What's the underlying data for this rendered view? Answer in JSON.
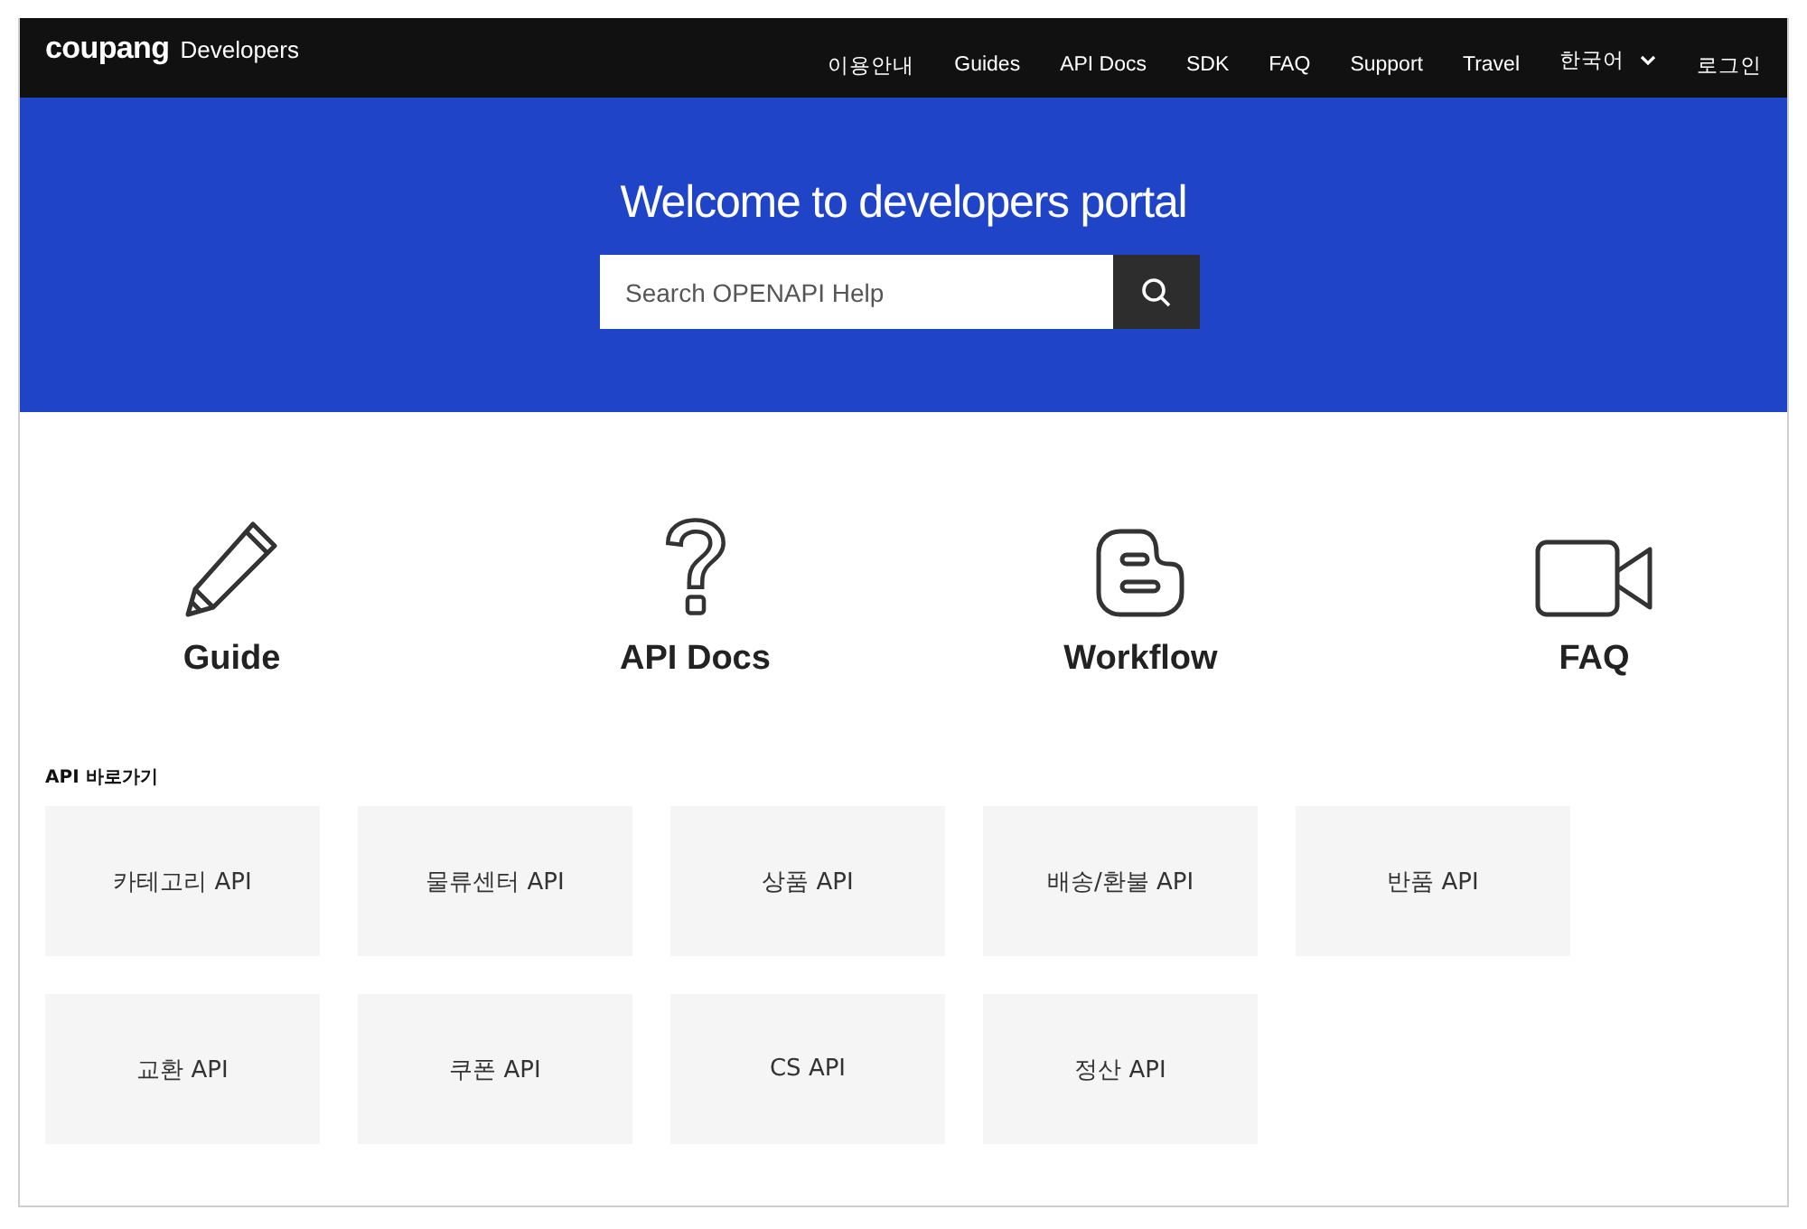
{
  "header": {
    "logo": "coupang",
    "logo_suffix": "Developers",
    "nav": [
      {
        "label": "이용안내"
      },
      {
        "label": "Guides"
      },
      {
        "label": "API Docs"
      },
      {
        "label": "SDK"
      },
      {
        "label": "FAQ"
      },
      {
        "label": "Support"
      },
      {
        "label": "Travel"
      }
    ],
    "language": "한국어",
    "login": "로그인"
  },
  "hero": {
    "title": "Welcome to developers portal",
    "search": {
      "placeholder": "Search OPENAPI Help"
    }
  },
  "features": [
    {
      "kind": "pencil",
      "label": "Guide"
    },
    {
      "kind": "question",
      "label": "API Docs"
    },
    {
      "kind": "blog",
      "label": "Workflow"
    },
    {
      "kind": "video",
      "label": "FAQ"
    }
  ],
  "shortcuts": {
    "heading": "API 바로가기",
    "items": [
      {
        "label": "카테고리 API"
      },
      {
        "label": "물류센터 API"
      },
      {
        "label": "상품 API"
      },
      {
        "label": "배송/환불 API"
      },
      {
        "label": "반품 API"
      },
      {
        "label": "교환 API"
      },
      {
        "label": "쿠폰 API"
      },
      {
        "label": "CS API"
      },
      {
        "label": "정산 API"
      }
    ]
  }
}
